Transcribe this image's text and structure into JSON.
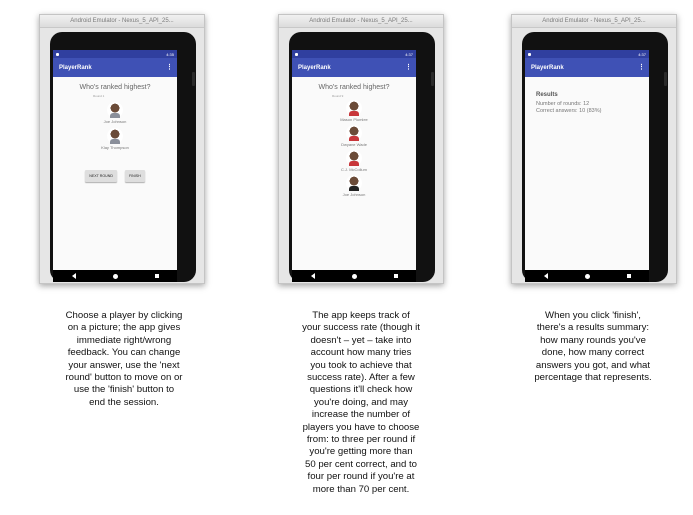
{
  "emulators": [
    {
      "window_title": "Android Emulator - Nexus_5_API_25...",
      "status_time": "4:35",
      "app_title": "PlayerRank",
      "menu_icon": "overflow-menu-icon"
    },
    {
      "window_title": "Android Emulator - Nexus_5_API_25...",
      "status_time": "4:37",
      "app_title": "PlayerRank",
      "menu_icon": "overflow-menu-icon"
    },
    {
      "window_title": "Android Emulator - Nexus_5_API_25...",
      "status_time": "4:37",
      "app_title": "PlayerRank",
      "menu_icon": "overflow-menu-icon"
    }
  ],
  "screen1": {
    "question": "Who's ranked highest?",
    "round_label": "Round 1",
    "players": [
      "Joe Johnson",
      "Klay Thompson"
    ],
    "next_button": "NEXT ROUND",
    "finish_button": "FINISH"
  },
  "screen2": {
    "question": "Who's ranked highest?",
    "round_label": "Round 9",
    "players": [
      "Mason Plumlee",
      "Dwyane Wade",
      "C.J. McCollum",
      "Joe Johnson"
    ]
  },
  "screen3": {
    "results_title": "Results",
    "rounds_line": "Number of rounds: 12",
    "correct_line": "Correct answers: 10 (83%)"
  },
  "captions": [
    "Choose a player by clicking\non a picture; the app gives\nimmediate right/wrong\nfeedback. You can change\nyour answer, use the 'next\nround' button to move on or\nuse the 'finish' button to\nend the session.",
    "The app keeps track of\nyour success rate (though it\ndoesn't – yet – take into\naccount how many tries\nyou took to achieve that\nsuccess rate). After a few\nquestions it'll check how\nyou're doing, and may\nincrease the number of\nplayers you have to choose\nfrom: to three per round if\nyou're getting more than\n50 per cent correct, and to\nfour per round if you're at\nmore than 70 per cent.",
    "When you click 'finish',\nthere's a results summary:\nhow many rounds you've\ndone, how many correct\nanswers you got, and what\npercentage that represents."
  ]
}
